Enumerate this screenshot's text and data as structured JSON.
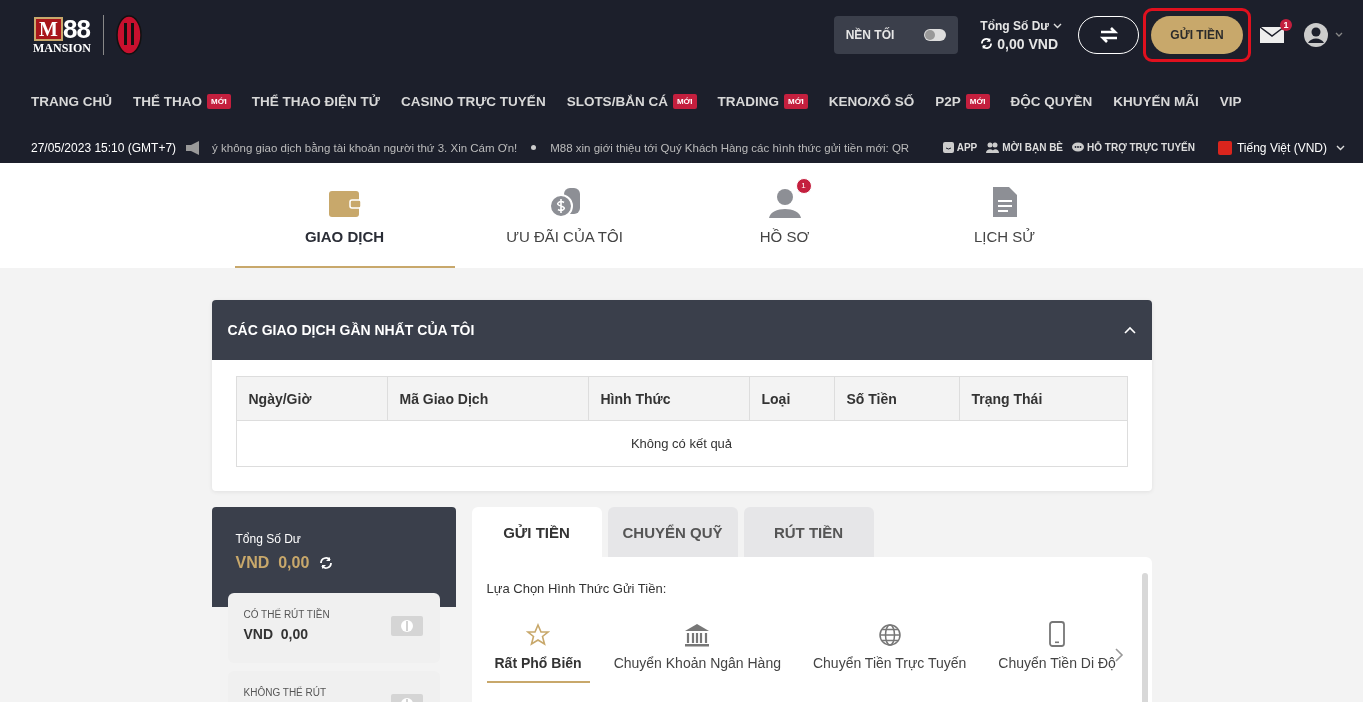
{
  "logo": {
    "mark": "M",
    "number": "88",
    "sub": "MANSION"
  },
  "dark_mode": {
    "label": "NỀN TỐI",
    "on": false
  },
  "balance": {
    "label": "Tổng Số Dư",
    "amount": "0,00 VND"
  },
  "deposit_button": "GỬI TIỀN",
  "mail_badge": "1",
  "nav": [
    {
      "label": "TRANG CHỦ"
    },
    {
      "label": "THỂ THAO",
      "badge": "MỚI"
    },
    {
      "label": "THỂ THAO ĐIỆN TỬ"
    },
    {
      "label": "CASINO TRỰC TUYẾN"
    },
    {
      "label": "SLOTS/BẮN CÁ",
      "badge": "MỚI"
    },
    {
      "label": "TRADING",
      "badge": "MỚI"
    },
    {
      "label": "KENO/XỔ SỐ"
    },
    {
      "label": "P2P",
      "badge": "MỚI"
    },
    {
      "label": "ĐỘC QUYỀN"
    },
    {
      "label": "KHUYẾN MÃI"
    },
    {
      "label": "VIP"
    }
  ],
  "ticker": {
    "datetime": "27/05/2023 15:10 (GMT+7)",
    "messages": [
      "ý không giao dịch bằng tài khoản người thứ 3. Xin Cám Ơn!",
      "M88 xin giới thiệu tới Quý Khách Hàng các hình thức gửi tiền mới: QR"
    ]
  },
  "quick_links": [
    {
      "kind": "app",
      "label": "APP"
    },
    {
      "kind": "friends",
      "label": "MỜI BẠN BÈ"
    },
    {
      "kind": "chat",
      "label": "HỖ TRỢ TRỰC TUYẾN"
    }
  ],
  "language": "Tiếng Việt (VND)",
  "tabs": [
    {
      "kind": "wallet",
      "label": "GIAO DỊCH",
      "selected": true
    },
    {
      "kind": "coins",
      "label": "ƯU ĐÃI CỦA TÔI",
      "selected": false
    },
    {
      "kind": "profile",
      "label": "HỒ SƠ",
      "selected": false,
      "badge": "1"
    },
    {
      "kind": "document",
      "label": "LỊCH SỬ",
      "selected": false
    }
  ],
  "transactions": {
    "title": "CÁC GIAO DỊCH GẦN NHẤT CỦA TÔI",
    "expanded": true,
    "columns": [
      "Ngày/Giờ",
      "Mã Giao Dịch",
      "Hình Thức",
      "Loại",
      "Số Tiền",
      "Trạng Thái"
    ],
    "empty": "Không có kết quả"
  },
  "wallet": {
    "label": "Tổng Số Dư",
    "currency": "VND",
    "amount": "0,00",
    "items": [
      {
        "label": "CÓ THỂ RÚT TIỀN",
        "currency": "VND",
        "amount": "0,00"
      },
      {
        "label": "KHÔNG THỂ RÚT"
      }
    ]
  },
  "fund_tabs": [
    {
      "label": "GỬI TIỀN",
      "selected": true
    },
    {
      "label": "CHUYỂN QUỸ",
      "selected": false
    },
    {
      "label": "RÚT TIỀN",
      "selected": false
    }
  ],
  "method_prompt": "Lựa Chọn Hình Thức Gửi Tiền:",
  "methods": [
    {
      "kind": "star",
      "label": "Rất Phổ Biến",
      "selected": true
    },
    {
      "kind": "bank",
      "label": "Chuyển Khoản Ngân Hàng",
      "selected": false
    },
    {
      "kind": "globe",
      "label": "Chuyển Tiền Trực Tuyến",
      "selected": false
    },
    {
      "kind": "phone",
      "label": "Chuyển Tiền Di Độ",
      "selected": false
    }
  ]
}
